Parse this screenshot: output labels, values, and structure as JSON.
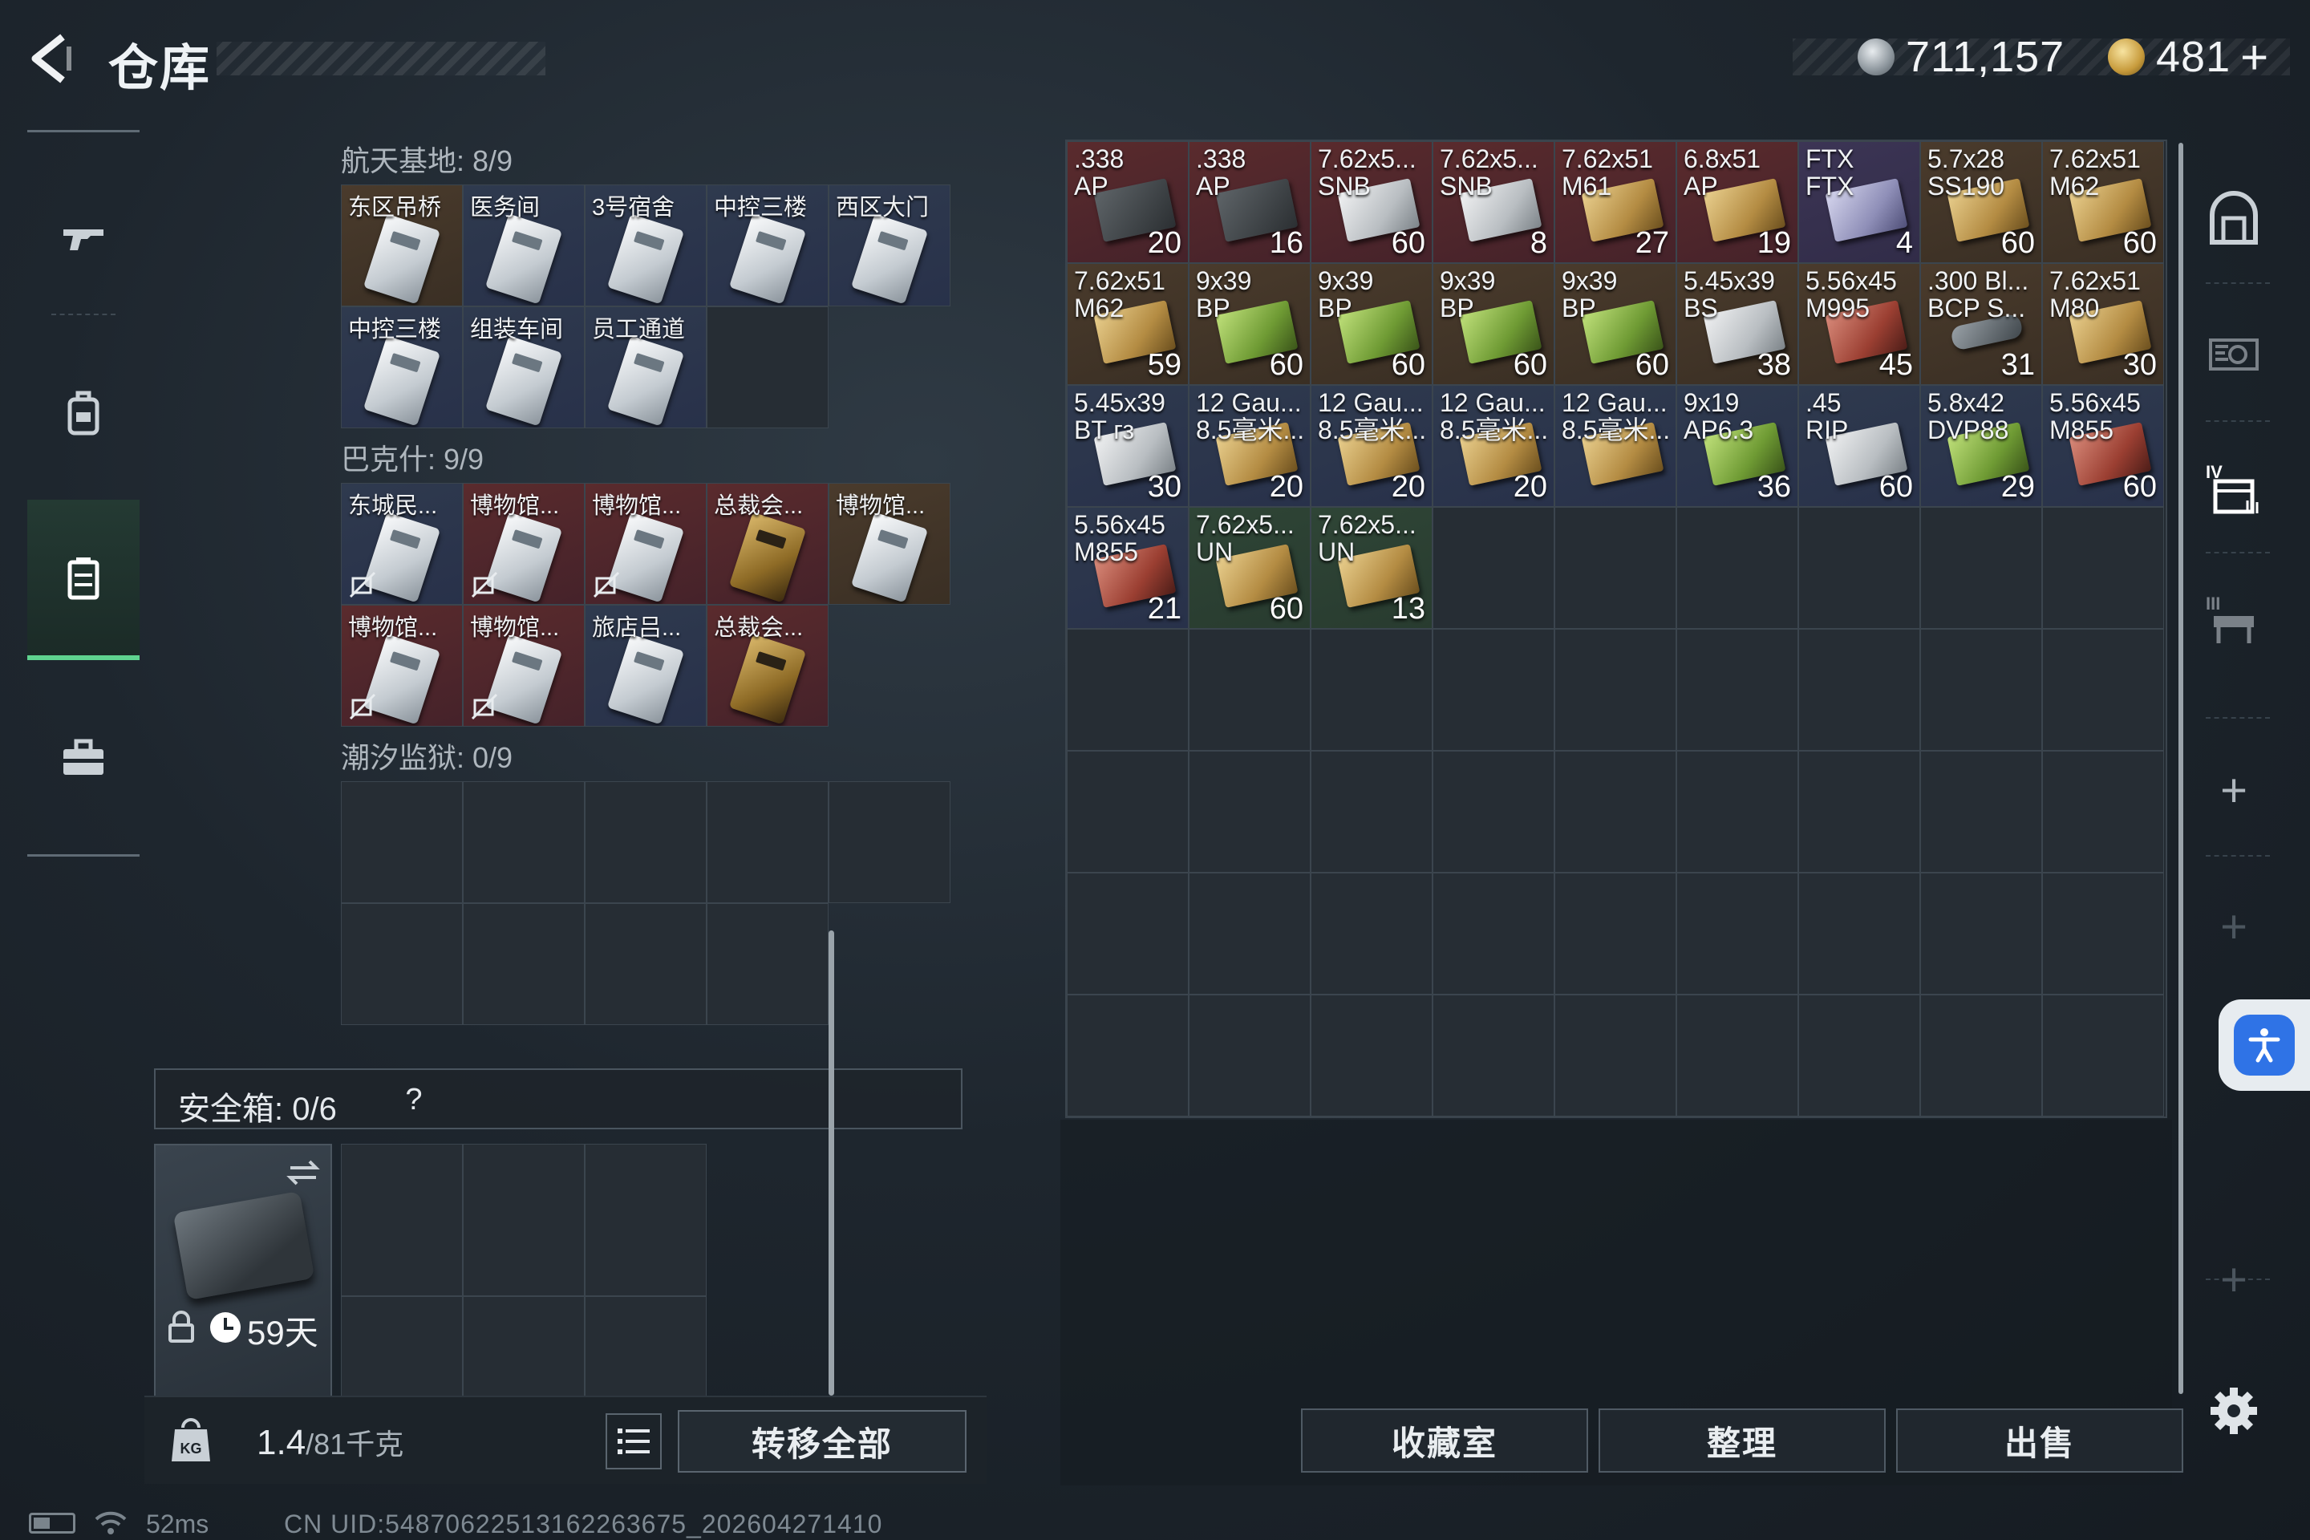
{
  "header": {
    "title": "仓库",
    "currency_silver": "711,157",
    "currency_gold": "481",
    "plus_label": "+"
  },
  "left_panel": {
    "sections": [
      {
        "label": "航天基地: 8/9",
        "items": [
          {
            "name": "东区吊桥",
            "card": "white",
            "bg": "brown",
            "no_mark": false
          },
          {
            "name": "医务间",
            "card": "white",
            "bg": "blue",
            "no_mark": false
          },
          {
            "name": "3号宿舍",
            "card": "white",
            "bg": "blue",
            "no_mark": false
          },
          {
            "name": "中控三楼",
            "card": "white",
            "bg": "blue",
            "no_mark": false
          },
          {
            "name": "西区大门",
            "card": "white",
            "bg": "blue",
            "no_mark": false
          },
          {
            "name": "中控三楼",
            "card": "white",
            "bg": "blue",
            "no_mark": false
          },
          {
            "name": "组装车间",
            "card": "white",
            "bg": "blue",
            "no_mark": false
          },
          {
            "name": "员工通道",
            "card": "white",
            "bg": "blue",
            "no_mark": false
          }
        ]
      },
      {
        "label": "巴克什: 9/9",
        "items": [
          {
            "name": "东城民...",
            "card": "white",
            "bg": "blue",
            "no_mark": true
          },
          {
            "name": "博物馆...",
            "card": "white",
            "bg": "red",
            "no_mark": true
          },
          {
            "name": "博物馆...",
            "card": "white",
            "bg": "red",
            "no_mark": true
          },
          {
            "name": "总裁会...",
            "card": "gold",
            "bg": "red",
            "no_mark": false
          },
          {
            "name": "博物馆...",
            "card": "white",
            "bg": "brown",
            "no_mark": false
          },
          {
            "name": "博物馆...",
            "card": "white",
            "bg": "red",
            "no_mark": true
          },
          {
            "name": "博物馆...",
            "card": "white",
            "bg": "red",
            "no_mark": true
          },
          {
            "name": "旅店吕...",
            "card": "white",
            "bg": "blue",
            "no_mark": false
          },
          {
            "name": "总裁会...",
            "card": "gold",
            "bg": "red",
            "no_mark": false
          }
        ]
      },
      {
        "label": "潮汐监狱: 0/9",
        "items": []
      }
    ],
    "safe_box": {
      "label": "安全箱: 0/6",
      "help": "?",
      "days": "59天"
    },
    "footer": {
      "weight_value": "1.4",
      "weight_suffix": "/81千克",
      "transfer_label": "转移全部"
    }
  },
  "stash": {
    "items": [
      {
        "name": ".338\nAP",
        "count": "20",
        "bg": "red",
        "box": "dark"
      },
      {
        "name": ".338\nAP",
        "count": "16",
        "bg": "red",
        "box": "dark"
      },
      {
        "name": "7.62x5...\nSNB",
        "count": "60",
        "bg": "red",
        "box": "white"
      },
      {
        "name": "7.62x5...\nSNB",
        "count": "8",
        "bg": "red",
        "box": "white"
      },
      {
        "name": "7.62x51\nM61",
        "count": "27",
        "bg": "red",
        "box": "tan"
      },
      {
        "name": "6.8x51\nAP",
        "count": "19",
        "bg": "red",
        "box": "tan"
      },
      {
        "name": "FTX\nFTX",
        "count": "4",
        "bg": "purple",
        "box": "purple"
      },
      {
        "name": "5.7x28\nSS190",
        "count": "60",
        "bg": "brown",
        "box": "tan"
      },
      {
        "name": "7.62x51\nM62",
        "count": "60",
        "bg": "brown",
        "box": "tan"
      },
      {
        "name": "7.62x51\nM62",
        "count": "59",
        "bg": "brown",
        "box": "tan"
      },
      {
        "name": "9x39\nBP",
        "count": "60",
        "bg": "brown",
        "box": "green"
      },
      {
        "name": "9x39\nBP",
        "count": "60",
        "bg": "brown",
        "box": "green"
      },
      {
        "name": "9x39\nBP",
        "count": "60",
        "bg": "brown",
        "box": "green"
      },
      {
        "name": "9x39\nBP",
        "count": "60",
        "bg": "brown",
        "box": "green"
      },
      {
        "name": "5.45x39\nBS",
        "count": "38",
        "bg": "brown",
        "box": "white"
      },
      {
        "name": "5.56x45\nM995",
        "count": "45",
        "bg": "brown",
        "box": "red"
      },
      {
        "name": ".300 Bl...\nBCP S...",
        "count": "31",
        "bg": "brown",
        "box": "round"
      },
      {
        "name": "7.62x51\nM80",
        "count": "30",
        "bg": "brown",
        "box": "tan"
      },
      {
        "name": "5.45x39\nBT гз",
        "count": "30",
        "bg": "blue",
        "box": "white"
      },
      {
        "name": "12 Gau...\n8.5毫米...",
        "count": "20",
        "bg": "blue",
        "box": "tan"
      },
      {
        "name": "12 Gau...\n8.5毫米...",
        "count": "20",
        "bg": "blue",
        "box": "tan"
      },
      {
        "name": "12 Gau...\n8.5毫米...",
        "count": "20",
        "bg": "blue",
        "box": "tan"
      },
      {
        "name": "12 Gau...\n8.5毫米...",
        "count": "",
        "bg": "blue",
        "box": "tan"
      },
      {
        "name": "9x19\nAP6.3",
        "count": "36",
        "bg": "blue",
        "box": "green"
      },
      {
        "name": ".45\nRIP",
        "count": "60",
        "bg": "blue",
        "box": "white"
      },
      {
        "name": "5.8x42\nDVP88",
        "count": "29",
        "bg": "blue",
        "box": "green"
      },
      {
        "name": "5.56x45\nM855",
        "count": "60",
        "bg": "blue",
        "box": "red"
      },
      {
        "name": "5.56x45\nM855",
        "count": "21",
        "bg": "blue",
        "box": "red"
      },
      {
        "name": "7.62x5...\nUN",
        "count": "60",
        "bg": "green",
        "box": "tan"
      },
      {
        "name": "7.62x5...\nUN",
        "count": "13",
        "bg": "green",
        "box": "tan"
      }
    ]
  },
  "bottom_buttons": {
    "collection": "收藏室",
    "sort": "整理",
    "sell": "出售"
  },
  "status_bar": {
    "ping": "52ms",
    "uid": "CN UID:5487062251316226​3675_202604271410"
  },
  "colors": {
    "accent_green": "#5fd38f",
    "accessibility_blue": "#2f73e6"
  }
}
